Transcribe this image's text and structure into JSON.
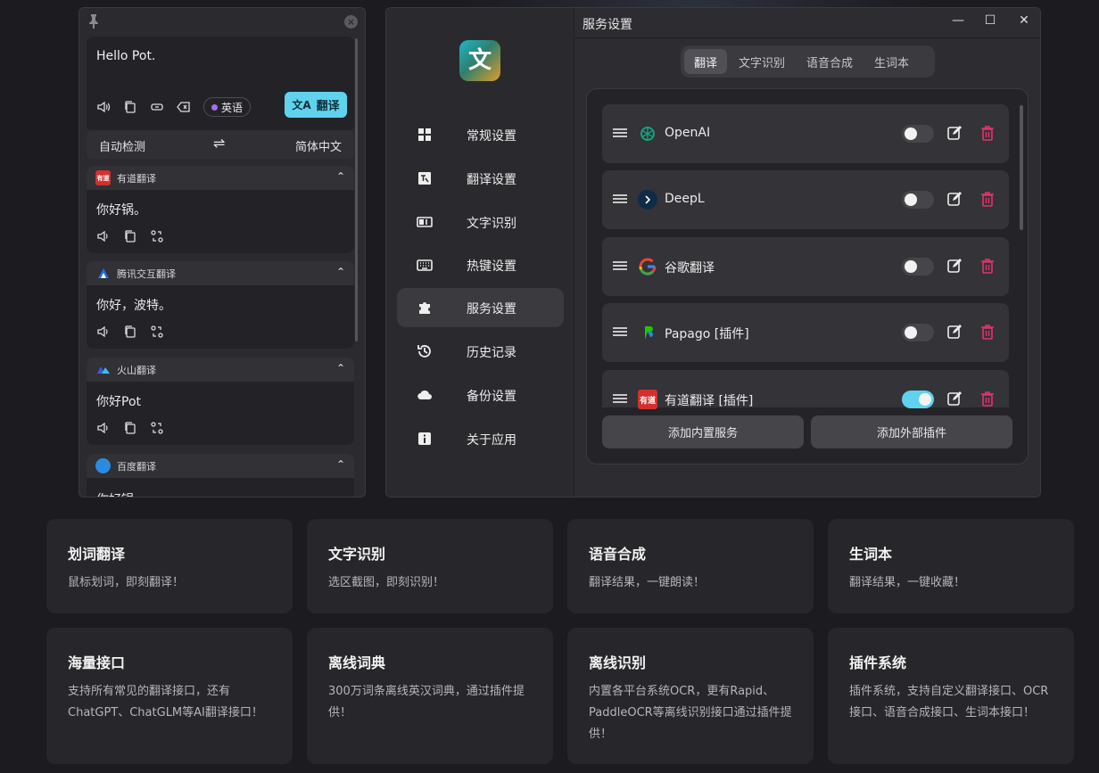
{
  "translate_window": {
    "source_text": "Hello Pot.",
    "target_lang_chip": "英语",
    "translate_button": "翻译",
    "from_lang": "自动检测",
    "swap_symbol": "⇌",
    "to_lang": "简体中文",
    "services": [
      {
        "name": "有道翻译",
        "logo_text": "有道",
        "logo_color": "#d32f2f",
        "result": "你好锅。"
      },
      {
        "name": "腾讯交互翻译",
        "logo_text": "",
        "logo_color": "#1f6feb",
        "result": "你好，波特。"
      },
      {
        "name": "火山翻译",
        "logo_text": "",
        "logo_color": "#3b5bdb",
        "result": "你好Pot"
      },
      {
        "name": "百度翻译",
        "logo_text": "",
        "logo_color": "#2b8be0",
        "result": "你好锅"
      }
    ]
  },
  "settings_window": {
    "title": "服务设置",
    "logo_glyph": "文",
    "controls": {
      "minimize": "—",
      "maximize": "☐",
      "close": "✕"
    },
    "nav": [
      {
        "label": "常规设置",
        "icon": "grid-icon"
      },
      {
        "label": "翻译设置",
        "icon": "image-translate-icon"
      },
      {
        "label": "文字识别",
        "icon": "ocr-icon"
      },
      {
        "label": "热键设置",
        "icon": "keyboard-icon"
      },
      {
        "label": "服务设置",
        "icon": "puzzle-icon",
        "active": true
      },
      {
        "label": "历史记录",
        "icon": "history-icon"
      },
      {
        "label": "备份设置",
        "icon": "cloud-icon"
      },
      {
        "label": "关于应用",
        "icon": "info-icon"
      }
    ],
    "tabs": [
      "翻译",
      "文字识别",
      "语音合成",
      "生词本"
    ],
    "active_tab": "翻译",
    "service_rows": [
      {
        "name": "OpenAI",
        "enabled": false,
        "logo_color": "#10a37f"
      },
      {
        "name": "DeepL",
        "enabled": false,
        "logo_color": "#0f2b46"
      },
      {
        "name": "谷歌翻译",
        "enabled": false,
        "logo_color": "#4285f4"
      },
      {
        "name": "Papago [插件]",
        "enabled": false,
        "logo_color": "#1ec800"
      },
      {
        "name": "有道翻译 [插件]",
        "enabled": true,
        "logo_color": "#d32f2f",
        "logo_text": "有道"
      }
    ],
    "add_builtin_button": "添加内置服务",
    "add_plugin_button": "添加外部插件"
  },
  "features": [
    {
      "title": "划词翻译",
      "desc": "鼠标划词，即刻翻译！"
    },
    {
      "title": "文字识别",
      "desc": "选区截图，即刻识别！"
    },
    {
      "title": "语音合成",
      "desc": "翻译结果，一键朗读！"
    },
    {
      "title": "生词本",
      "desc": "翻译结果，一键收藏！"
    },
    {
      "title": "海量接口",
      "desc": "支持所有常见的翻译接口，还有ChatGPT、ChatGLM等AI翻译接口！"
    },
    {
      "title": "离线词典",
      "desc": "300万词条离线英汉词典，通过插件提供！"
    },
    {
      "title": "离线识别",
      "desc": "内置各平台系统OCR，更有Rapid、PaddleOCR等离线识别接口通过插件提供！"
    },
    {
      "title": "插件系统",
      "desc": "插件系统，支持自定义翻译接口、OCR接口、语音合成接口、生词本接口！"
    }
  ]
}
